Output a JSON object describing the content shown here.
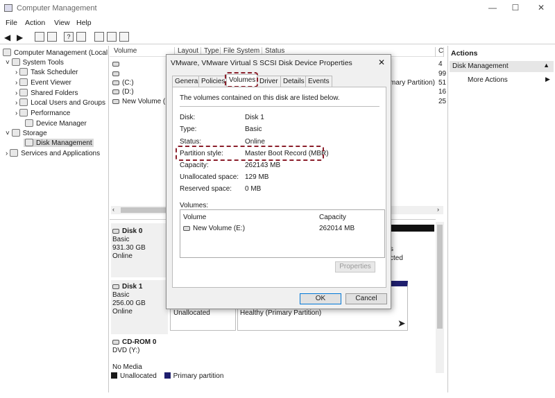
{
  "window": {
    "title": "Computer Management",
    "min": "—",
    "max": "☐",
    "close": "✕"
  },
  "menu": [
    "File",
    "Action",
    "View",
    "Help"
  ],
  "tree": {
    "root": "Computer Management (Local",
    "system_tools": "System Tools",
    "task_scheduler": "Task Scheduler",
    "event_viewer": "Event Viewer",
    "shared_folders": "Shared Folders",
    "local_users": "Local Users and Groups",
    "performance": "Performance",
    "device_manager": "Device Manager",
    "storage": "Storage",
    "disk_management": "Disk Management",
    "services": "Services and Applications"
  },
  "columns": [
    "Volume",
    "Layout",
    "Type",
    "File System",
    "Status",
    "C"
  ],
  "volumes": [
    "",
    "",
    "(C:)",
    "(D:)",
    "New Volume (E"
  ],
  "right_values": [
    "4",
    "99",
    "51",
    "16",
    "25"
  ],
  "partial_status": "mary Partition)",
  "disks": [
    {
      "name": "Disk 0",
      "type": "Basic",
      "size": "931.30 GB",
      "state": "Online"
    },
    {
      "name": "Disk 1",
      "type": "Basic",
      "size": "256.00 GB",
      "state": "Online"
    },
    {
      "name": "CD-ROM 0",
      "type": "DVD (Y:)",
      "size": "",
      "state": "No Media"
    }
  ],
  "disk0_partial": [
    "s",
    "cted"
  ],
  "disk1_parts": {
    "unallocated": "Unallocated",
    "primary": "Healthy (Primary Partition)"
  },
  "legend": {
    "unallocated": "Unallocated",
    "primary": "Primary partition",
    "unallocated_color": "#1a1a1a",
    "primary_color": "#1f1f6e"
  },
  "actions": {
    "header": "Actions",
    "section": "Disk Management",
    "more": "More Actions"
  },
  "dialog": {
    "title": "VMware, VMware Virtual S SCSI Disk Device Properties",
    "tabs": [
      "General",
      "Policies",
      "Volumes",
      "Driver",
      "Details",
      "Events"
    ],
    "intro": "The volumes contained on this disk are listed below.",
    "props": [
      {
        "label": "Disk:",
        "value": "Disk 1"
      },
      {
        "label": "Type:",
        "value": "Basic"
      },
      {
        "label": "Status:",
        "value": "Online"
      },
      {
        "label": "Partition style:",
        "value": "Master Boot Record (MBR)"
      },
      {
        "label": "Capacity:",
        "value": "262143 MB"
      },
      {
        "label": "Unallocated space:",
        "value": "129 MB"
      },
      {
        "label": "Reserved space:",
        "value": "0 MB"
      }
    ],
    "volumes_label": "Volumes:",
    "vol_col_volume": "Volume",
    "vol_col_capacity": "Capacity",
    "vol_row_name": "New Volume (E:)",
    "vol_row_capacity": "262014 MB",
    "properties_btn": "Properties",
    "ok": "OK",
    "cancel": "Cancel"
  }
}
